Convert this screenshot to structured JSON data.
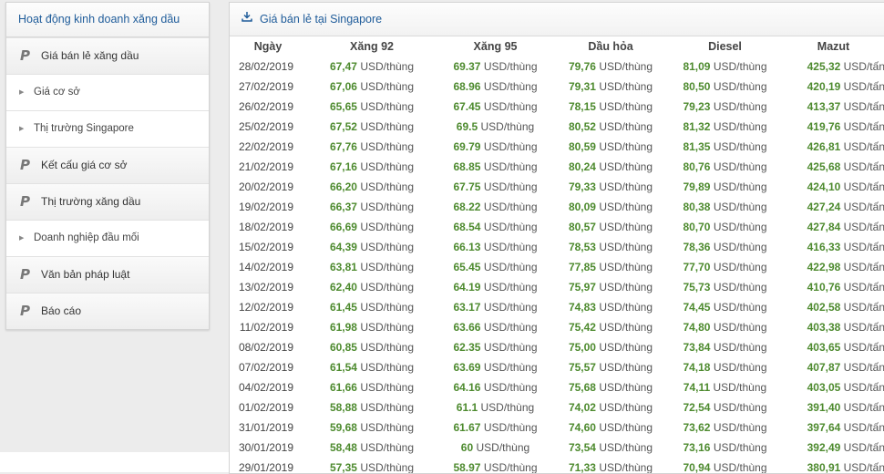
{
  "sidebar": {
    "title": "Hoạt động kinh doanh xăng dầu",
    "main_icon": "P",
    "items": [
      {
        "label": "Giá bán lẻ xăng dầu",
        "type": "main"
      },
      {
        "label": "Giá cơ sở",
        "type": "sub"
      },
      {
        "label": "Thị trường Singapore",
        "type": "sub"
      },
      {
        "label": "Kết cấu giá cơ sở",
        "type": "main"
      },
      {
        "label": "Thị trường xăng dầu",
        "type": "main"
      },
      {
        "label": "Doanh nghiệp đầu mối",
        "type": "sub"
      },
      {
        "label": "Văn bản pháp luật",
        "type": "main"
      },
      {
        "label": "Báo cáo",
        "type": "main"
      }
    ]
  },
  "panel": {
    "title": "Giá bán lẻ tại Singapore",
    "icon": "download-icon"
  },
  "table": {
    "headers": [
      "Ngày",
      "Xăng 92",
      "Xăng 95",
      "Dầu hỏa",
      "Diesel",
      "Mazut"
    ],
    "unit_barrel": "USD/thùng",
    "unit_ton": "USD/tấn",
    "rows": [
      {
        "date": "28/02/2019",
        "x92": "67,47",
        "x95": "69.37",
        "dh": "79,76",
        "ds": "81,09",
        "mz": "425,32"
      },
      {
        "date": "27/02/2019",
        "x92": "67,06",
        "x95": "68.96",
        "dh": "79,31",
        "ds": "80,50",
        "mz": "420,19"
      },
      {
        "date": "26/02/2019",
        "x92": "65,65",
        "x95": "67.45",
        "dh": "78,15",
        "ds": "79,23",
        "mz": "413,37"
      },
      {
        "date": "25/02/2019",
        "x92": "67,52",
        "x95": "69.5",
        "dh": "80,52",
        "ds": "81,32",
        "mz": "419,76"
      },
      {
        "date": "22/02/2019",
        "x92": "67,76",
        "x95": "69.79",
        "dh": "80,59",
        "ds": "81,35",
        "mz": "426,81"
      },
      {
        "date": "21/02/2019",
        "x92": "67,16",
        "x95": "68.85",
        "dh": "80,24",
        "ds": "80,76",
        "mz": "425,68"
      },
      {
        "date": "20/02/2019",
        "x92": "66,20",
        "x95": "67.75",
        "dh": "79,33",
        "ds": "79,89",
        "mz": "424,10"
      },
      {
        "date": "19/02/2019",
        "x92": "66,37",
        "x95": "68.22",
        "dh": "80,09",
        "ds": "80,38",
        "mz": "427,24"
      },
      {
        "date": "18/02/2019",
        "x92": "66,69",
        "x95": "68.54",
        "dh": "80,57",
        "ds": "80,70",
        "mz": "427,84"
      },
      {
        "date": "15/02/2019",
        "x92": "64,39",
        "x95": "66.13",
        "dh": "78,53",
        "ds": "78,36",
        "mz": "416,33"
      },
      {
        "date": "14/02/2019",
        "x92": "63,81",
        "x95": "65.45",
        "dh": "77,85",
        "ds": "77,70",
        "mz": "422,98"
      },
      {
        "date": "13/02/2019",
        "x92": "62,40",
        "x95": "64.19",
        "dh": "75,97",
        "ds": "75,73",
        "mz": "410,76"
      },
      {
        "date": "12/02/2019",
        "x92": "61,45",
        "x95": "63.17",
        "dh": "74,83",
        "ds": "74,45",
        "mz": "402,58"
      },
      {
        "date": "11/02/2019",
        "x92": "61,98",
        "x95": "63.66",
        "dh": "75,42",
        "ds": "74,80",
        "mz": "403,38"
      },
      {
        "date": "08/02/2019",
        "x92": "60,85",
        "x95": "62.35",
        "dh": "75,00",
        "ds": "73,84",
        "mz": "403,65"
      },
      {
        "date": "07/02/2019",
        "x92": "61,54",
        "x95": "63.69",
        "dh": "75,57",
        "ds": "74,18",
        "mz": "407,87"
      },
      {
        "date": "04/02/2019",
        "x92": "61,66",
        "x95": "64.16",
        "dh": "75,68",
        "ds": "74,11",
        "mz": "403,05"
      },
      {
        "date": "01/02/2019",
        "x92": "58,88",
        "x95": "61.1",
        "dh": "74,02",
        "ds": "72,54",
        "mz": "391,40"
      },
      {
        "date": "31/01/2019",
        "x92": "59,68",
        "x95": "61.67",
        "dh": "74,60",
        "ds": "73,62",
        "mz": "397,64"
      },
      {
        "date": "30/01/2019",
        "x92": "58,48",
        "x95": "60",
        "dh": "73,54",
        "ds": "73,16",
        "mz": "392,49"
      },
      {
        "date": "29/01/2019",
        "x92": "57,35",
        "x95": "58.97",
        "dh": "71,33",
        "ds": "70,94",
        "mz": "380,91"
      }
    ]
  },
  "colors": {
    "link_blue": "#1f5c9a",
    "value_green": "#4d8a2e"
  }
}
